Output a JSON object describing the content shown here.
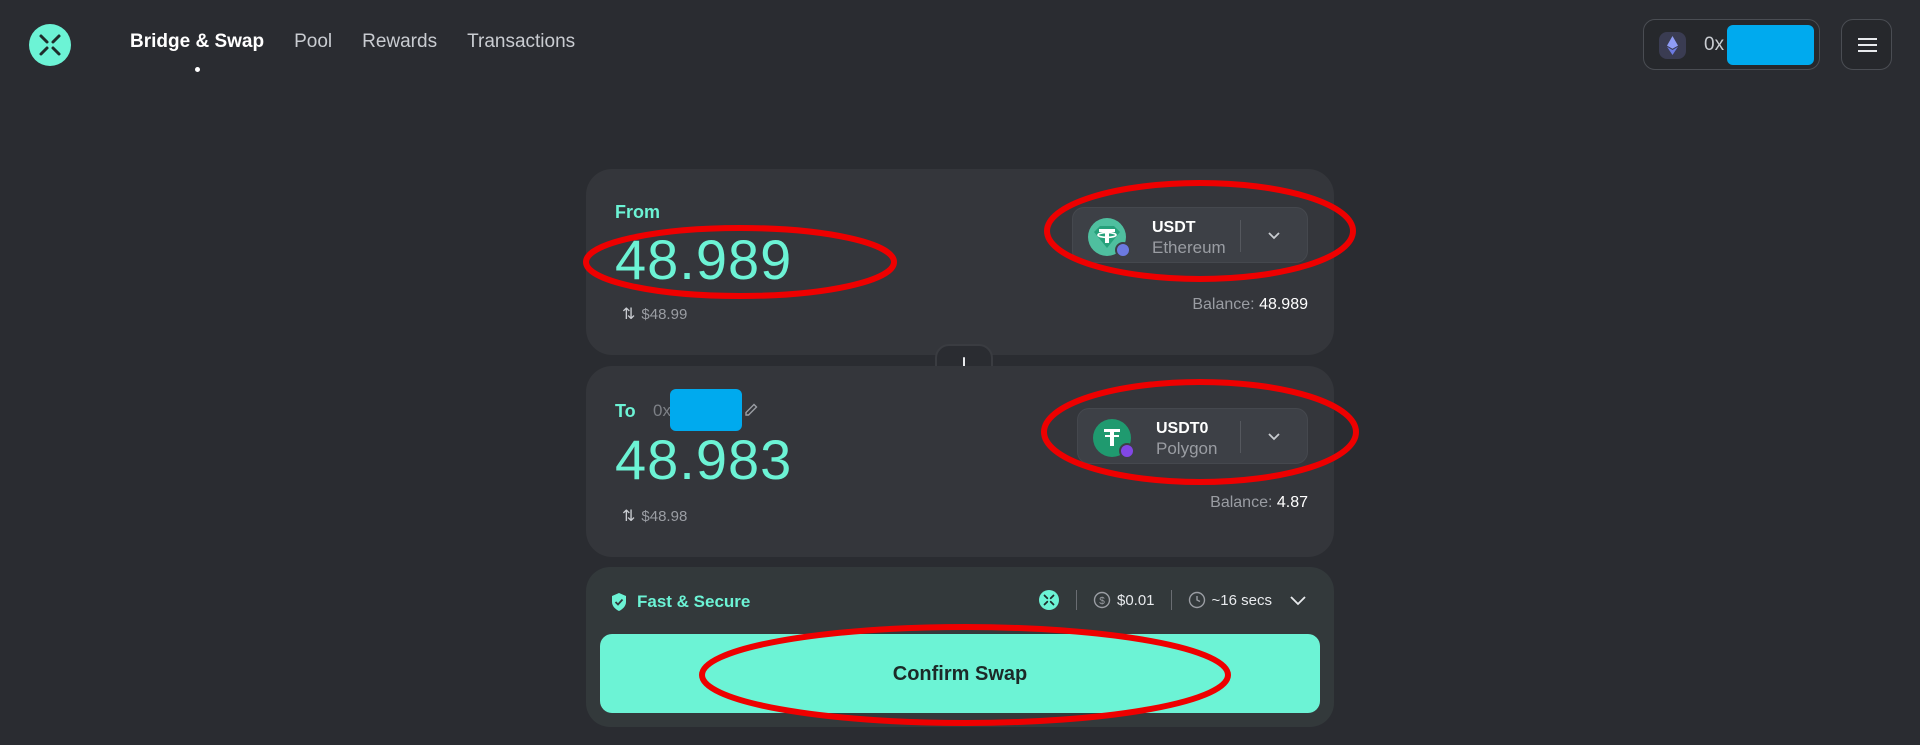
{
  "nav": {
    "items": [
      "Bridge & Swap",
      "Pool",
      "Rewards",
      "Transactions"
    ],
    "active_index": 0
  },
  "wallet": {
    "address_prefix": "0x"
  },
  "from": {
    "label": "From",
    "amount": "48.989",
    "usd_value": "$48.99",
    "token": "USDT",
    "chain": "Ethereum",
    "balance_label": "Balance:",
    "balance_value": "48.989"
  },
  "to": {
    "label": "To",
    "address_prefix": "0x",
    "amount": "48.983",
    "usd_value": "$48.98",
    "token": "USDT0",
    "chain": "Polygon",
    "balance_label": "Balance:",
    "balance_value": "4.87"
  },
  "route": {
    "title": "Fast & Secure",
    "fee": "$0.01",
    "time": "~16 secs"
  },
  "confirm_label": "Confirm Swap",
  "colors": {
    "accent": "#6cf3d5",
    "background": "#2a2c31",
    "card": "#34363b",
    "annotation": "#ee0000",
    "redaction": "#00aaee",
    "tether": "#26a17b",
    "polygon": "#8247e5"
  },
  "icons": {
    "logo": "bridge-logo-icon",
    "wallet_chain": "ethereum-icon",
    "menu": "hamburger-menu-icon",
    "swap_direction": "arrow-down-icon",
    "edit": "pencil-icon",
    "fast_secure": "shield-check-icon",
    "fee": "dollar-circle-icon",
    "time": "clock-icon"
  }
}
